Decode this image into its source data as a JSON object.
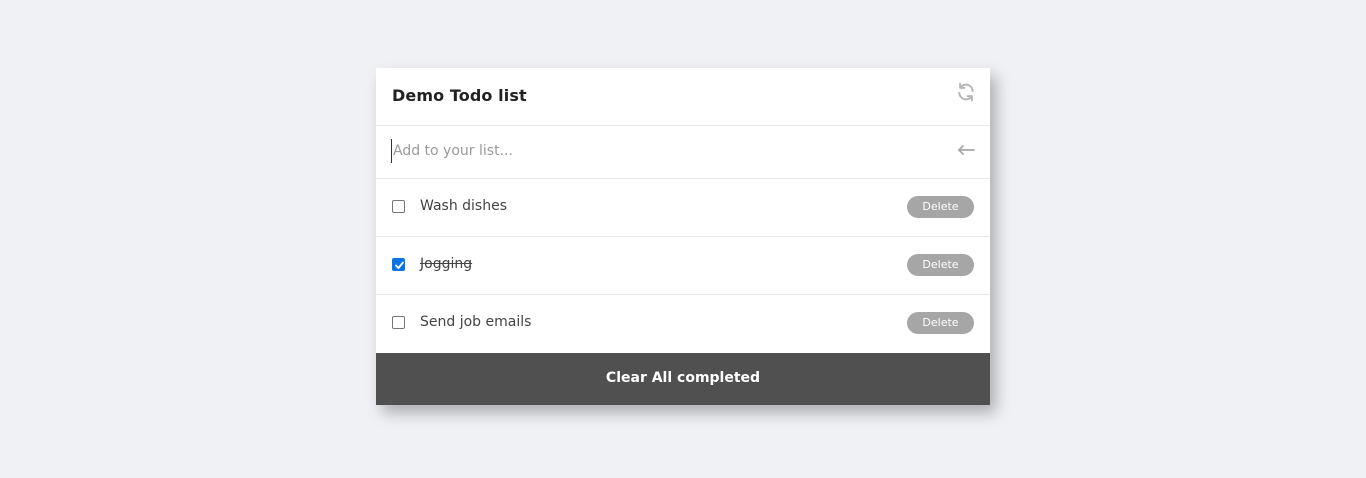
{
  "card": {
    "title": "Demo Todo list",
    "refresh_icon": "refresh-icon"
  },
  "add": {
    "placeholder": "Add to your list...",
    "value": "",
    "submit_icon": "arrow-left-icon"
  },
  "items": [
    {
      "label": "Wash dishes",
      "completed": false,
      "delete_label": "Delete"
    },
    {
      "label": "Jogging",
      "completed": true,
      "delete_label": "Delete"
    },
    {
      "label": "Send job emails",
      "completed": false,
      "delete_label": "Delete"
    }
  ],
  "footer": {
    "clear_label": "Clear All completed"
  },
  "colors": {
    "background": "#f0f1f5",
    "card": "#ffffff",
    "footer": "#505050",
    "delete_button": "#a6a6a6",
    "checkbox_checked": "#0b74e5"
  }
}
